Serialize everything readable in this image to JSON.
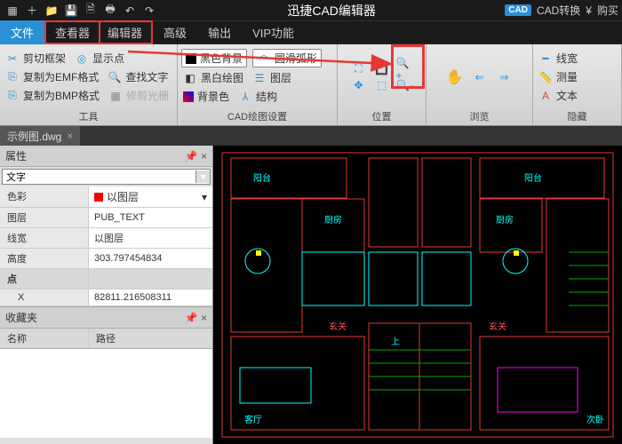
{
  "app": {
    "title": "迅捷CAD编辑器",
    "cad_convert": "CAD转换",
    "buy": "购买"
  },
  "menu": {
    "file": "文件",
    "viewer": "查看器",
    "editor": "编辑器",
    "advanced": "高级",
    "output": "输出",
    "vip": "VIP功能"
  },
  "ribbon": {
    "tools": {
      "label": "工具",
      "clip_frame": "剪切框架",
      "copy_emf": "复制为EMF格式",
      "copy_bmp": "复制为BMP格式",
      "show_point": "显示点",
      "find_text": "查找文字",
      "repair_block": "修剪光栅"
    },
    "cad_settings": {
      "label": "CAD绘图设置",
      "black_bg": "黑色背景",
      "black_white": "黑白绘图",
      "bg_color": "背景色",
      "smooth_arc": "圆滑弧形",
      "layers": "图层",
      "structure": "结构"
    },
    "position": {
      "label": "位置"
    },
    "browse": {
      "label": "浏览"
    },
    "hidden": {
      "label": "隐藏",
      "linewidth": "线宽",
      "measure": "测量",
      "text": "文本"
    }
  },
  "doc": {
    "tab_name": "示例图.dwg"
  },
  "props": {
    "panel_title": "属性",
    "type_value": "文字",
    "rows": [
      {
        "key": "色彩",
        "val": "以图层",
        "swatch": true
      },
      {
        "key": "图层",
        "val": "PUB_TEXT"
      },
      {
        "key": "线宽",
        "val": "以图层"
      },
      {
        "key": "高度",
        "val": "303.797454834"
      }
    ],
    "section2": "点",
    "rows2": [
      {
        "key": "X",
        "val": "82811.216508311"
      }
    ]
  },
  "favorites": {
    "title": "收藏夹",
    "col_name": "名称",
    "col_path": "路径"
  },
  "rooms": {
    "balcony1": "阳台",
    "balcony2": "阳台",
    "kitchen1": "厨房",
    "kitchen2": "厨房",
    "ting1": "客厅",
    "entry1": "玄关",
    "entry2": "玄关",
    "living2": "次卧",
    "stair": "上"
  }
}
